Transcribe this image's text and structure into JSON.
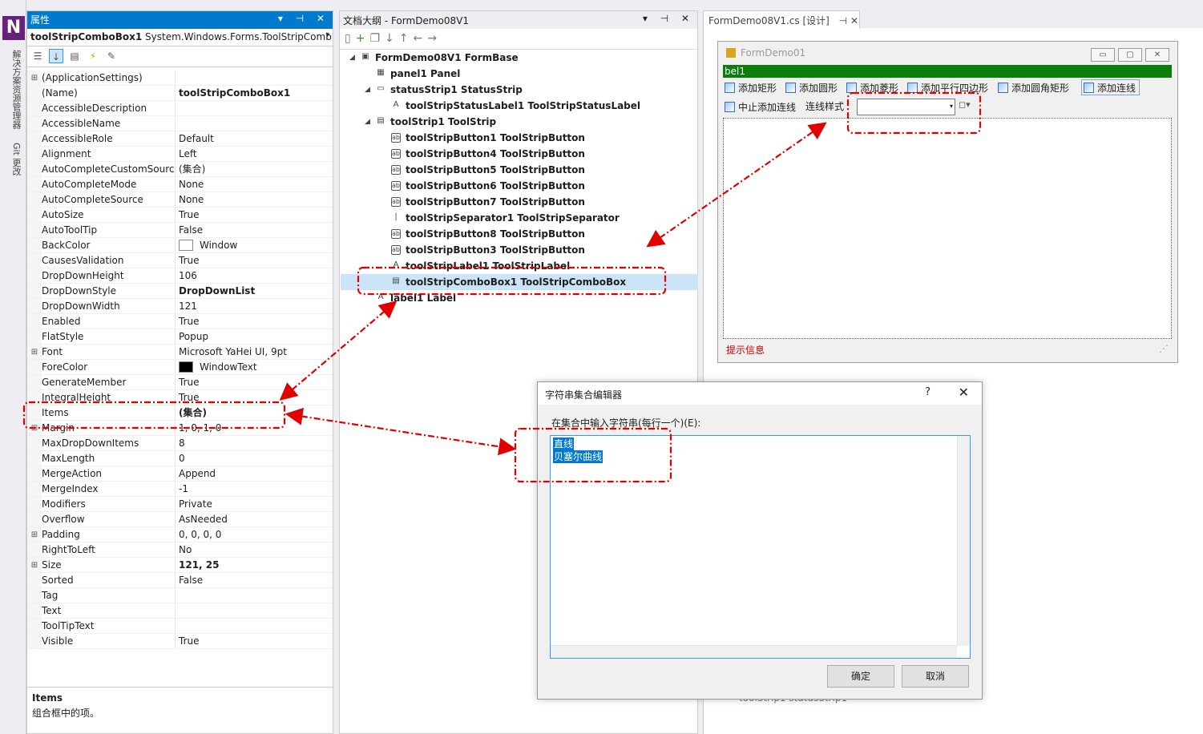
{
  "sidebar": {
    "logo": "N",
    "tabs": [
      "解决方案资源管理器",
      "Git 更改"
    ]
  },
  "properties": {
    "title": "属性",
    "buttons": "▾ ⊣ ✕",
    "object_name": "toolStripComboBox1",
    "object_type": "System.Windows.Forms.ToolStripComb",
    "rows": [
      {
        "exp": "⊞",
        "name": "(ApplicationSettings)",
        "value": ""
      },
      {
        "exp": "",
        "name": "(Name)",
        "value": "toolStripComboBox1",
        "bold": true
      },
      {
        "exp": "",
        "name": "AccessibleDescription",
        "value": ""
      },
      {
        "exp": "",
        "name": "AccessibleName",
        "value": ""
      },
      {
        "exp": "",
        "name": "AccessibleRole",
        "value": "Default"
      },
      {
        "exp": "",
        "name": "Alignment",
        "value": "Left"
      },
      {
        "exp": "",
        "name": "AutoCompleteCustomSource",
        "value": "(集合)"
      },
      {
        "exp": "",
        "name": "AutoCompleteMode",
        "value": "None"
      },
      {
        "exp": "",
        "name": "AutoCompleteSource",
        "value": "None"
      },
      {
        "exp": "",
        "name": "AutoSize",
        "value": "True"
      },
      {
        "exp": "",
        "name": "AutoToolTip",
        "value": "False"
      },
      {
        "exp": "",
        "name": "BackColor",
        "value": "Window",
        "swatch": "#ffffff"
      },
      {
        "exp": "",
        "name": "CausesValidation",
        "value": "True"
      },
      {
        "exp": "",
        "name": "DropDownHeight",
        "value": "106"
      },
      {
        "exp": "",
        "name": "DropDownStyle",
        "value": "DropDownList",
        "bold": true
      },
      {
        "exp": "",
        "name": "DropDownWidth",
        "value": "121"
      },
      {
        "exp": "",
        "name": "Enabled",
        "value": "True"
      },
      {
        "exp": "",
        "name": "FlatStyle",
        "value": "Popup"
      },
      {
        "exp": "⊞",
        "name": "Font",
        "value": "Microsoft YaHei UI, 9pt"
      },
      {
        "exp": "",
        "name": "ForeColor",
        "value": "WindowText",
        "swatch": "#000000"
      },
      {
        "exp": "",
        "name": "GenerateMember",
        "value": "True"
      },
      {
        "exp": "",
        "name": "IntegralHeight",
        "value": "True"
      },
      {
        "exp": "",
        "name": "Items",
        "value": "(集合)",
        "bold": true
      },
      {
        "exp": "⊞",
        "name": "Margin",
        "value": "1, 0, 1, 0"
      },
      {
        "exp": "",
        "name": "MaxDropDownItems",
        "value": "8"
      },
      {
        "exp": "",
        "name": "MaxLength",
        "value": "0"
      },
      {
        "exp": "",
        "name": "MergeAction",
        "value": "Append"
      },
      {
        "exp": "",
        "name": "MergeIndex",
        "value": "-1"
      },
      {
        "exp": "",
        "name": "Modifiers",
        "value": "Private"
      },
      {
        "exp": "",
        "name": "Overflow",
        "value": "AsNeeded"
      },
      {
        "exp": "⊞",
        "name": "Padding",
        "value": "0, 0, 0, 0"
      },
      {
        "exp": "",
        "name": "RightToLeft",
        "value": "No"
      },
      {
        "exp": "⊞",
        "name": "Size",
        "value": "121, 25",
        "bold": true
      },
      {
        "exp": "",
        "name": "Sorted",
        "value": "False"
      },
      {
        "exp": "",
        "name": "Tag",
        "value": ""
      },
      {
        "exp": "",
        "name": "Text",
        "value": ""
      },
      {
        "exp": "",
        "name": "ToolTipText",
        "value": ""
      },
      {
        "exp": "",
        "name": "Visible",
        "value": "True"
      }
    ],
    "desc_title": "Items",
    "desc_text": "组合框中的项。"
  },
  "outline": {
    "title": "文档大纲 - FormDemo08V1",
    "buttons": "▾ ⊣ ✕",
    "nodes": [
      {
        "twist": "◢",
        "icon": "▣",
        "text": "FormDemo08V1  FormBase",
        "lvl": 0
      },
      {
        "twist": "",
        "icon": "▦",
        "text": "panel1  Panel",
        "lvl": 1
      },
      {
        "twist": "◢",
        "icon": "▭",
        "text": "statusStrip1  StatusStrip",
        "lvl": 1
      },
      {
        "twist": "",
        "icon": "A",
        "text": "toolStripStatusLabel1  ToolStripStatusLabel",
        "lvl": 2
      },
      {
        "twist": "◢",
        "icon": "▤",
        "text": "toolStrip1  ToolStrip",
        "lvl": 1
      },
      {
        "twist": "",
        "icon": "ab",
        "text": "toolStripButton1  ToolStripButton",
        "lvl": 2,
        "box": true
      },
      {
        "twist": "",
        "icon": "ab",
        "text": "toolStripButton4  ToolStripButton",
        "lvl": 2,
        "box": true
      },
      {
        "twist": "",
        "icon": "ab",
        "text": "toolStripButton5  ToolStripButton",
        "lvl": 2,
        "box": true
      },
      {
        "twist": "",
        "icon": "ab",
        "text": "toolStripButton6  ToolStripButton",
        "lvl": 2,
        "box": true
      },
      {
        "twist": "",
        "icon": "ab",
        "text": "toolStripButton7  ToolStripButton",
        "lvl": 2,
        "box": true
      },
      {
        "twist": "",
        "icon": "|",
        "text": "toolStripSeparator1  ToolStripSeparator",
        "lvl": 2
      },
      {
        "twist": "",
        "icon": "ab",
        "text": "toolStripButton8  ToolStripButton",
        "lvl": 2,
        "box": true
      },
      {
        "twist": "",
        "icon": "ab",
        "text": "toolStripButton3  ToolStripButton",
        "lvl": 2,
        "box": true
      },
      {
        "twist": "",
        "icon": "A",
        "text": "toolStripLabel1  ToolStripLabel",
        "lvl": 2
      },
      {
        "twist": "",
        "icon": "▤",
        "text": "toolStripComboBox1  ToolStripComboBox",
        "lvl": 2
      },
      {
        "twist": "",
        "icon": "A",
        "text": "label1  Label",
        "lvl": 1
      }
    ]
  },
  "designer": {
    "tab": "FormDemo08V1.cs [设计]",
    "tab_buttons": "⊣ ✕",
    "form_title": "FormDemo01",
    "label_text": "bel1",
    "toolbar_row1": [
      "添加矩形",
      "添加圆形",
      "添加菱形",
      "添加平行四边形",
      "添加圆角矩形",
      "添加连线"
    ],
    "stop_button": "中止添加连线",
    "line_style_label": "连线样式",
    "status_text": "提示信息",
    "tray": "toolStrip1      statusStrip1"
  },
  "dialog": {
    "title": "字符串集合编辑器",
    "help": "?",
    "close": "✕",
    "label": "在集合中输入字符串(每行一个)(E):",
    "lines": [
      "直线",
      "贝塞尔曲线"
    ],
    "ok": "确定",
    "cancel": "取消"
  },
  "colors": {
    "accent": "#007acc",
    "highlight": "#e00000",
    "green": "#0a7d0a"
  }
}
